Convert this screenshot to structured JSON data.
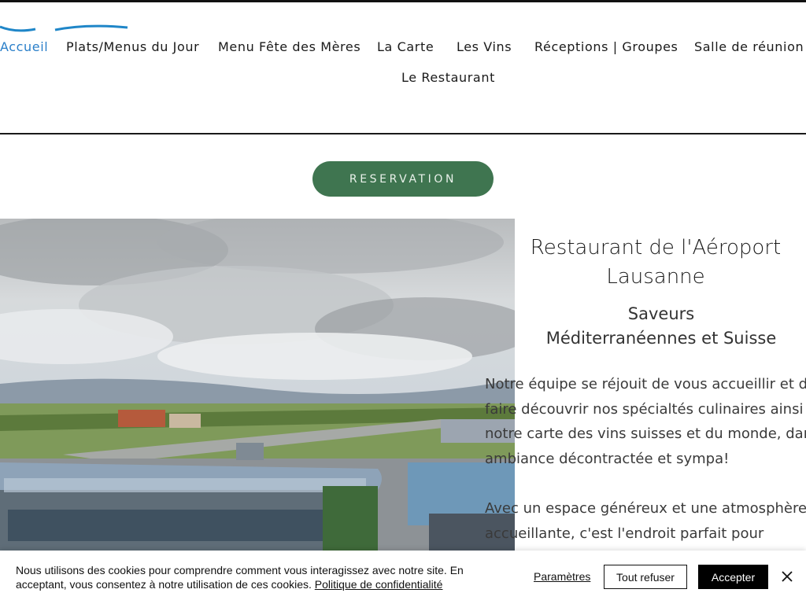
{
  "nav": {
    "items": [
      {
        "label": "Accueil",
        "active": true
      },
      {
        "label": "Plats/Menus du Jour"
      },
      {
        "label": "Menu Fête des Mères"
      },
      {
        "label": "La Carte"
      },
      {
        "label": "Les Vins"
      },
      {
        "label": "Réceptions | Groupes"
      },
      {
        "label": "Salle de réunion"
      },
      {
        "label": "Le Restaurant"
      }
    ]
  },
  "reservation": {
    "label": "RESERVATION"
  },
  "intro": {
    "title_line1": "Restaurant de l'Aéroport",
    "title_line2": "Lausanne",
    "subtitle_line1": "Saveurs",
    "subtitle_line2": "Méditerranéennes et Suisse",
    "paragraph1": [
      "Notre équipe se réjouit de vous accueillir et de",
      "faire découvrir nos spécialtés culinaires ainsi",
      "notre carte des vins suisses et du monde, dans",
      "ambiance décontractée et sympa!"
    ],
    "paragraph2": [
      "Avec un espace généreux et une atmosphère",
      "accueillante, c'est l'endroit parfait pour"
    ]
  },
  "cookie": {
    "text": "Nous utilisons des cookies pour comprendre comment vous interagissez avec notre site. En acceptant, vous consentez à notre utilisation de ces cookies.",
    "policy_link": "Politique de confidentialité",
    "settings_label": "Paramètres",
    "refuse_label": "Tout refuser",
    "accept_label": "Accepter"
  },
  "colors": {
    "accent": "#2a7fc9",
    "reservation_button": "#3f7550"
  },
  "icons": {
    "close": "close-icon",
    "logo": "logo-swoosh"
  }
}
